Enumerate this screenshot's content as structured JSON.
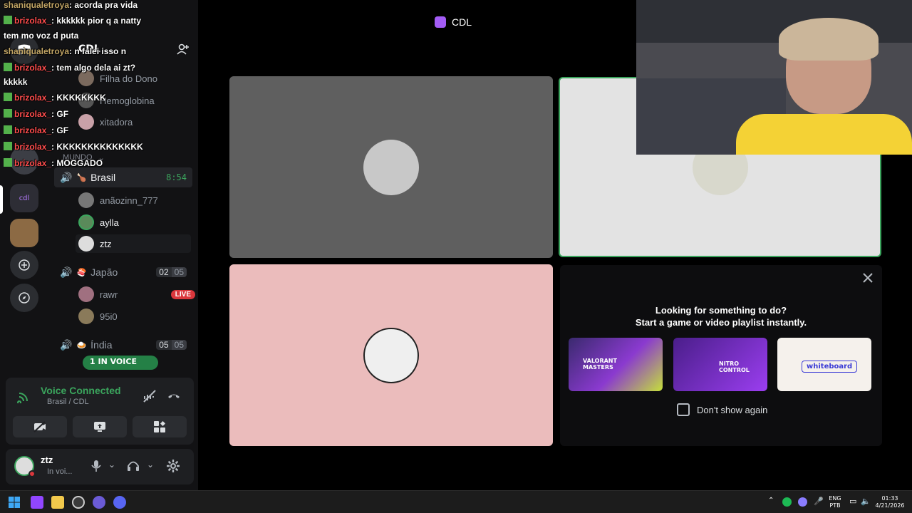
{
  "stage": {
    "title": "CDL"
  },
  "server": {
    "name": "CDL"
  },
  "channels": {
    "top_members": [
      "Filha do Dono",
      "Hemoglobina",
      "xitadora"
    ],
    "category": "MUNDO",
    "brasil": {
      "name": "Brasil",
      "time": "8:54",
      "members": [
        "anãozinn_777",
        "aylla",
        "ztz"
      ]
    },
    "japao": {
      "name": "Japão",
      "count": "02",
      "cap": "05",
      "members": [
        "rawr",
        "95i0"
      ],
      "live": "LIVE"
    },
    "india": {
      "name": "Índia",
      "count": "05",
      "cap": "05",
      "in_voice": "1 IN VOICE"
    }
  },
  "voice": {
    "status": "Voice Connected",
    "location": "Brasil / CDL"
  },
  "user": {
    "name": "ztz",
    "status": "In voi..."
  },
  "activity": {
    "line1": "Looking for something to do?",
    "line2": "Start a game or video playlist instantly.",
    "dont_show": "Don't show again",
    "cards": [
      "VALORANT MASTERS",
      "NITRO CONTROL",
      "whiteboard"
    ]
  },
  "chat": [
    {
      "user": "shaniqualetroya",
      "msg": ": acorda pra vida",
      "color": "a"
    },
    {
      "user": "brizolax_",
      "msg": ": kkkkkk pior q a natty",
      "color": "b",
      "badge": true
    },
    {
      "user": "",
      "msg": "tem mo voz d puta",
      "color": ""
    },
    {
      "user": "shaniqualetroya",
      "msg": ": n falei isso n",
      "color": "a"
    },
    {
      "user": "brizolax_",
      "msg": ": tem algo dela ai zt?",
      "color": "b",
      "badge": true
    },
    {
      "user": "",
      "msg": "kkkkk",
      "color": ""
    },
    {
      "user": "brizolax_",
      "msg": ": KKKKKKKK",
      "color": "b",
      "badge": true
    },
    {
      "user": "brizolax_",
      "msg": ": GF",
      "color": "b",
      "badge": true
    },
    {
      "user": "brizolax_",
      "msg": ": GF",
      "color": "b",
      "badge": true
    },
    {
      "user": "brizolax_",
      "msg": ": KKKKKKKKKKKKKK",
      "color": "b",
      "badge": true
    },
    {
      "user": "brizolax_",
      "msg": ": MOGGADO",
      "color": "b",
      "badge": true
    }
  ],
  "taskbar": {
    "lang1": "ENG",
    "lang2": "PTB",
    "time": "01:33",
    "date": "4/21/2026"
  },
  "colors": {
    "accent": "#3ba55d",
    "live": "#da373c",
    "tile_gray": "#5f5f5f",
    "tile_pink": "#ebbcbc",
    "tile_light": "#e3e3e3"
  }
}
